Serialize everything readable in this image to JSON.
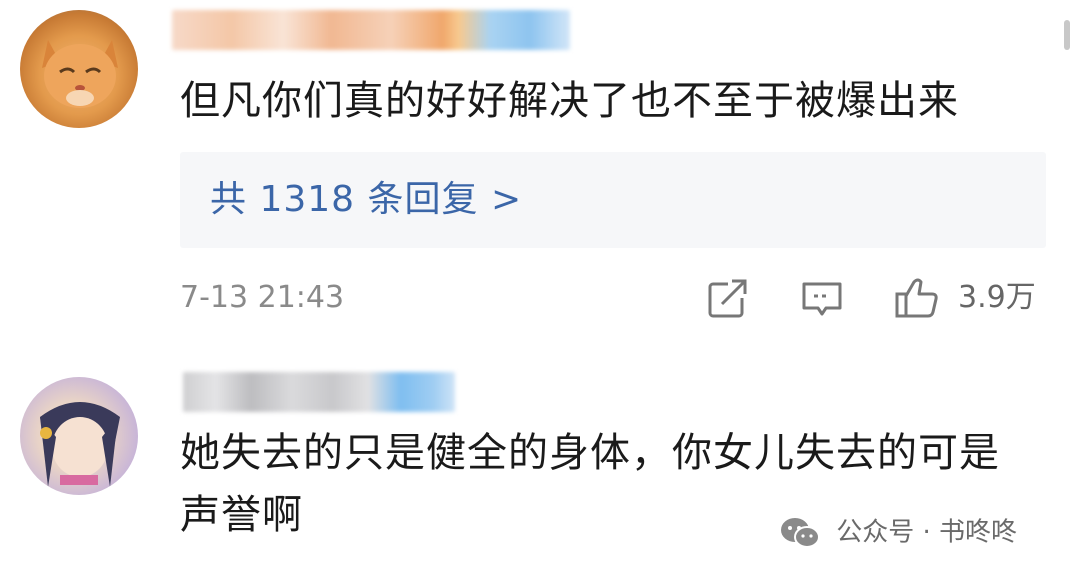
{
  "comments": [
    {
      "text": "但凡你们真的好好解决了也不至于被爆出来",
      "reply_summary": "共 1318 条回复 >",
      "timestamp": "7-13 21:43",
      "like_count": "3.9万"
    },
    {
      "text_line1": "她失去的只是健全的身体，你女儿失去的可是",
      "text_line2": "声誉啊"
    }
  ],
  "watermark": {
    "text": "公众号 · 书咚咚",
    "icon": "wechat-icon"
  },
  "icons": {
    "share": "share-icon",
    "comment": "comment-icon",
    "like": "thumbs-up-icon"
  },
  "colors": {
    "reply_link": "#3b66a8",
    "reply_bg": "#f6f7f9",
    "meta_text": "#8a8a8a"
  }
}
